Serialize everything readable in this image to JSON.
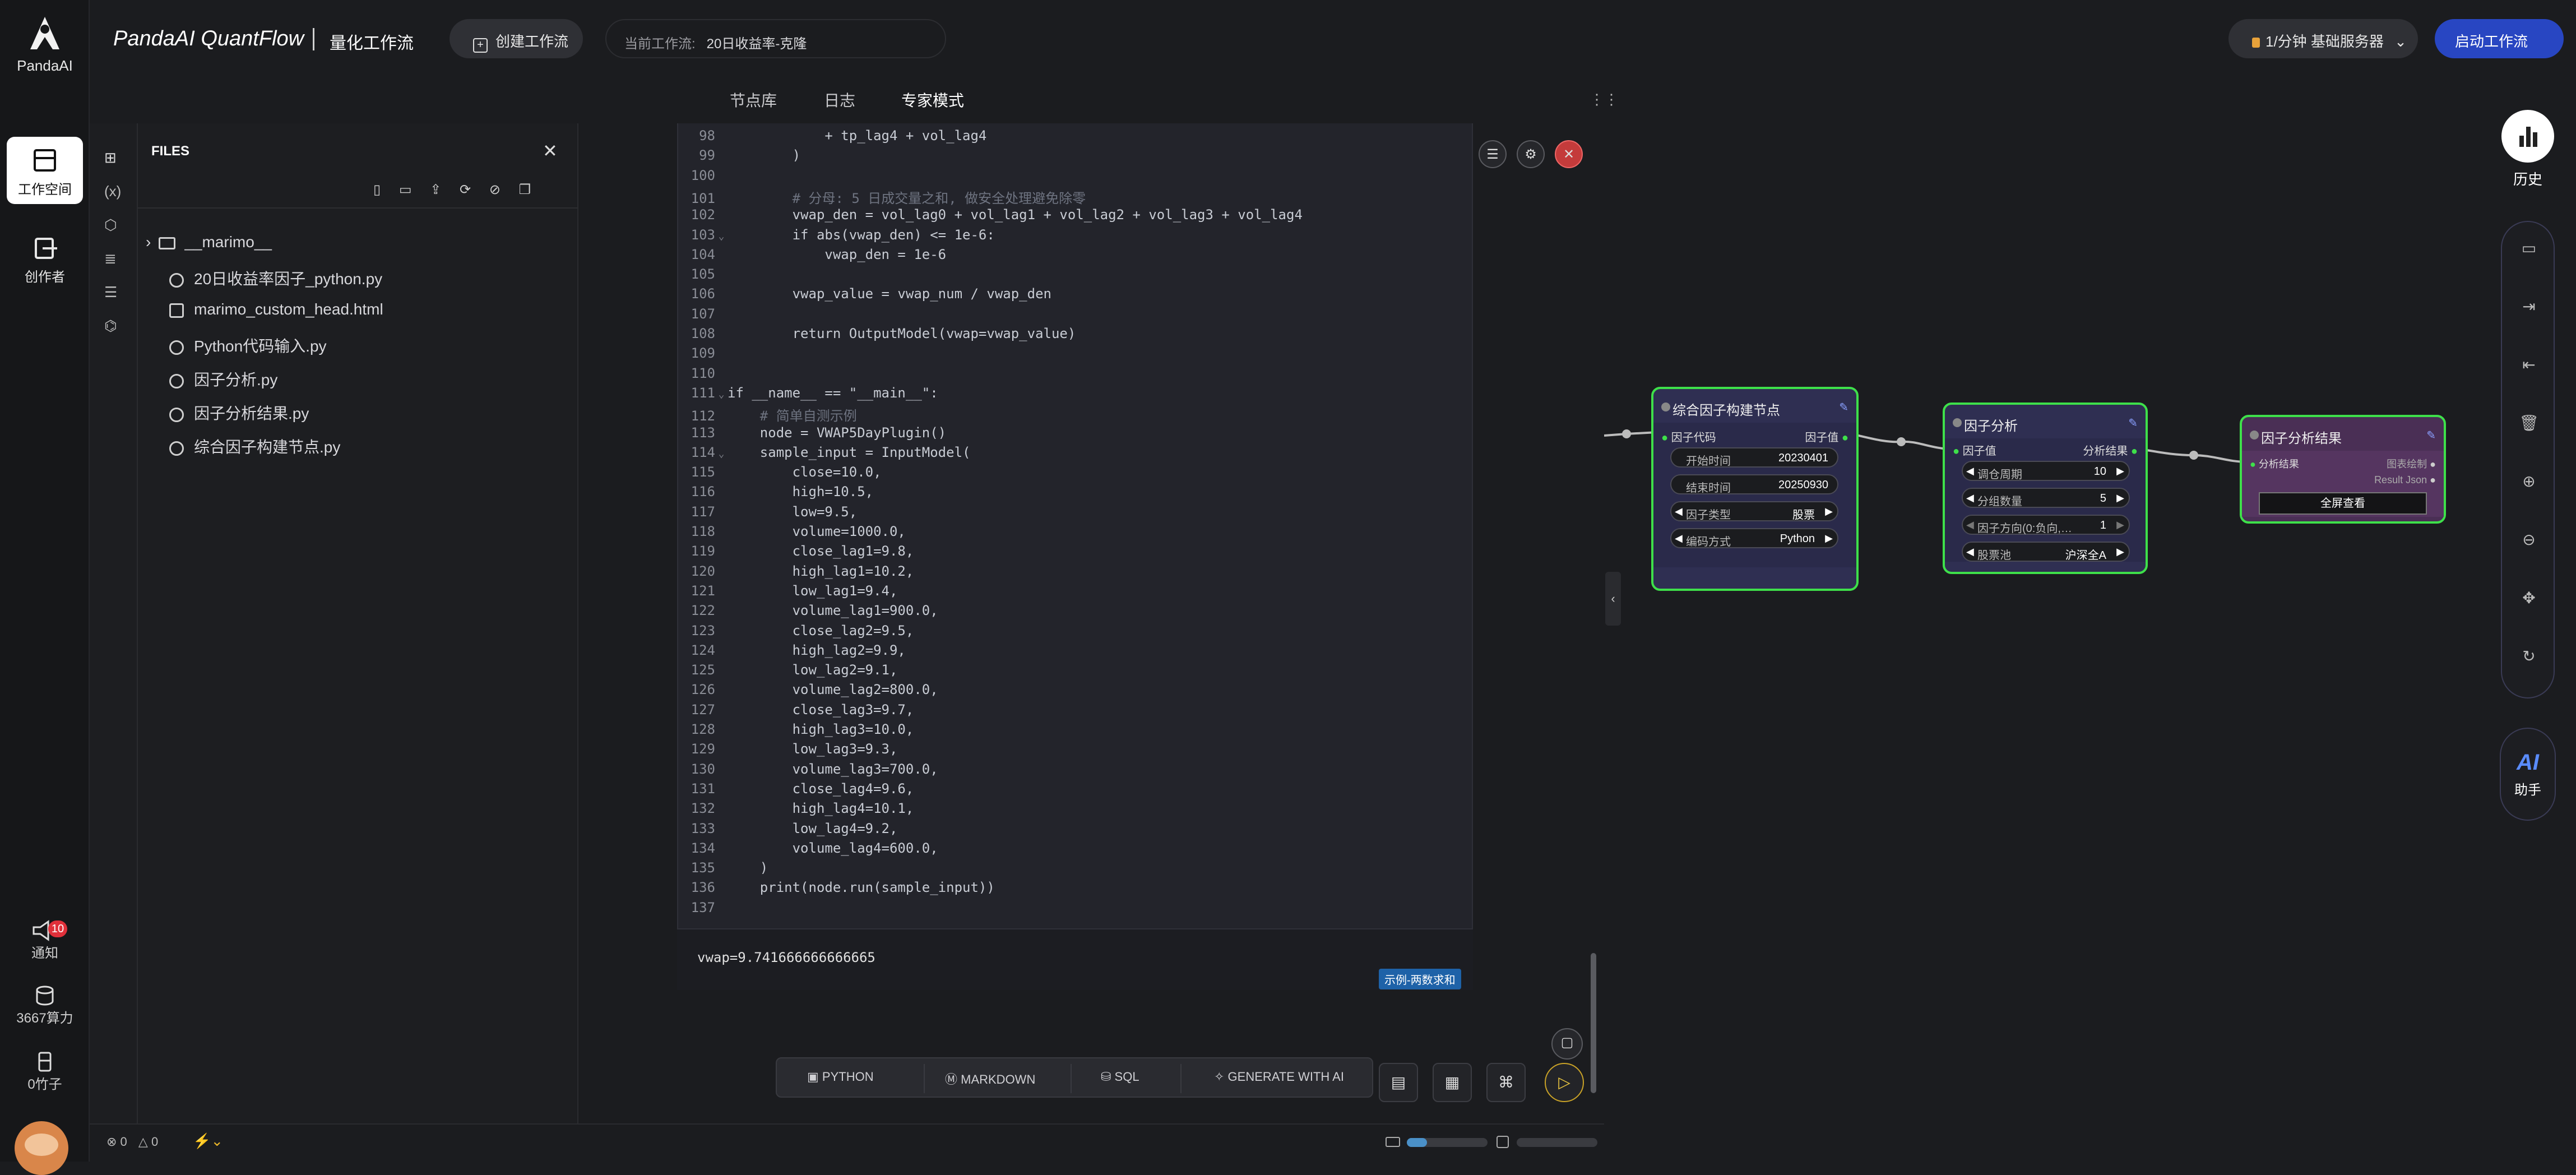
{
  "rail": {
    "logo_text": "PandaAI",
    "workspace": "工作空间",
    "author": "创作者",
    "notify": "通知",
    "notify_badge": "10",
    "compute": "3667算力",
    "bamboo": "0竹子"
  },
  "topbar": {
    "brand": "PandaAI QuantFlow",
    "subtitle": "量化工作流",
    "create_btn": "创建工作流",
    "current_label": "当前工作流:",
    "current_value": "20日收益率-克隆",
    "server": "1/分钟  基础服务器",
    "run_btn": "启动工作流"
  },
  "subnav": {
    "tab1": "节点库",
    "tab2": "日志",
    "tab3": "专家模式"
  },
  "files": {
    "title": "FILES",
    "items": [
      "__marimo__",
      "20日收益率因子_python.py",
      "marimo_custom_head.html",
      "Python代码输入.py",
      "因子分析.py",
      "因子分析结果.py",
      "综合因子构建节点.py"
    ]
  },
  "code": [
    {
      "n": "98",
      "f": "",
      "t": "            + tp_lag4 + vol_lag4"
    },
    {
      "n": "99",
      "f": "",
      "t": "        )"
    },
    {
      "n": "100",
      "f": "",
      "t": ""
    },
    {
      "n": "101",
      "f": "",
      "t": "        # 分母: 5 日成交量之和, 做安全处理避免除零"
    },
    {
      "n": "102",
      "f": "",
      "t": "        vwap_den = vol_lag0 + vol_lag1 + vol_lag2 + vol_lag3 + vol_lag4"
    },
    {
      "n": "103",
      "f": "⌄",
      "t": "        if abs(vwap_den) <= 1e-6:"
    },
    {
      "n": "104",
      "f": "",
      "t": "            vwap_den = 1e-6"
    },
    {
      "n": "105",
      "f": "",
      "t": ""
    },
    {
      "n": "106",
      "f": "",
      "t": "        vwap_value = vwap_num / vwap_den"
    },
    {
      "n": "107",
      "f": "",
      "t": ""
    },
    {
      "n": "108",
      "f": "",
      "t": "        return OutputModel(vwap=vwap_value)"
    },
    {
      "n": "109",
      "f": "",
      "t": ""
    },
    {
      "n": "110",
      "f": "",
      "t": ""
    },
    {
      "n": "111",
      "f": "⌄",
      "t": "if __name__ == \"__main__\":"
    },
    {
      "n": "112",
      "f": "",
      "t": "    # 简单自测示例"
    },
    {
      "n": "113",
      "f": "",
      "t": "    node = VWAP5DayPlugin()"
    },
    {
      "n": "114",
      "f": "⌄",
      "t": "    sample_input = InputModel("
    },
    {
      "n": "115",
      "f": "",
      "t": "        close=10.0,"
    },
    {
      "n": "116",
      "f": "",
      "t": "        high=10.5,"
    },
    {
      "n": "117",
      "f": "",
      "t": "        low=9.5,"
    },
    {
      "n": "118",
      "f": "",
      "t": "        volume=1000.0,"
    },
    {
      "n": "119",
      "f": "",
      "t": "        close_lag1=9.8,"
    },
    {
      "n": "120",
      "f": "",
      "t": "        high_lag1=10.2,"
    },
    {
      "n": "121",
      "f": "",
      "t": "        low_lag1=9.4,"
    },
    {
      "n": "122",
      "f": "",
      "t": "        volume_lag1=900.0,"
    },
    {
      "n": "123",
      "f": "",
      "t": "        close_lag2=9.5,"
    },
    {
      "n": "124",
      "f": "",
      "t": "        high_lag2=9.9,"
    },
    {
      "n": "125",
      "f": "",
      "t": "        low_lag2=9.1,"
    },
    {
      "n": "126",
      "f": "",
      "t": "        volume_lag2=800.0,"
    },
    {
      "n": "127",
      "f": "",
      "t": "        close_lag3=9.7,"
    },
    {
      "n": "128",
      "f": "",
      "t": "        high_lag3=10.0,"
    },
    {
      "n": "129",
      "f": "",
      "t": "        low_lag3=9.3,"
    },
    {
      "n": "130",
      "f": "",
      "t": "        volume_lag3=700.0,"
    },
    {
      "n": "131",
      "f": "",
      "t": "        close_lag4=9.6,"
    },
    {
      "n": "132",
      "f": "",
      "t": "        high_lag4=10.1,"
    },
    {
      "n": "133",
      "f": "",
      "t": "        low_lag4=9.2,"
    },
    {
      "n": "134",
      "f": "",
      "t": "        volume_lag4=600.0,"
    },
    {
      "n": "135",
      "f": "",
      "t": "    )"
    },
    {
      "n": "136",
      "f": "",
      "t": "    print(node.run(sample_input))"
    },
    {
      "n": "137",
      "f": "",
      "t": ""
    }
  ],
  "output": {
    "text": "vwap=9.741666666666665",
    "example_tag": "示例-两数求和"
  },
  "bottombar": {
    "python": "PYTHON",
    "markdown": "MARKDOWN",
    "sql": "SQL",
    "ai": "GENERATE WITH AI"
  },
  "status": {
    "errors": "0",
    "warnings": "0"
  },
  "nodes": {
    "n1": {
      "title": "综合因子构建节点",
      "in_port": "因子代码",
      "out_port": "因子值",
      "f1_k": "开始时间",
      "f1_v": "20230401",
      "f2_k": "结束时间",
      "f2_v": "20250930",
      "f3_k": "因子类型",
      "f3_v": "股票",
      "f4_k": "编码方式",
      "f4_v": "Python"
    },
    "n2": {
      "title": "因子分析",
      "in_port": "因子值",
      "out_port": "分析结果",
      "f1_k": "调仓周期",
      "f1_v": "10",
      "f2_k": "分组数量",
      "f2_v": "5",
      "f3_k": "因子方向(0:负向,…",
      "f3_v": "1",
      "f4_k": "股票池",
      "f4_v": "沪深全A"
    },
    "n3": {
      "title": "因子分析结果",
      "in_port": "分析结果",
      "out1": "图表绘制",
      "out2": "Result Json",
      "button": "全屏查看"
    }
  },
  "right_sidebar": {
    "history": "历史",
    "ai_logo": "AI",
    "assistant": "助手"
  },
  "colors": {
    "accent_blue": "#2846c2",
    "node_border": "#3ee04a",
    "node_bg": "#2f2f52",
    "node3_bg": "#4a2f55"
  }
}
